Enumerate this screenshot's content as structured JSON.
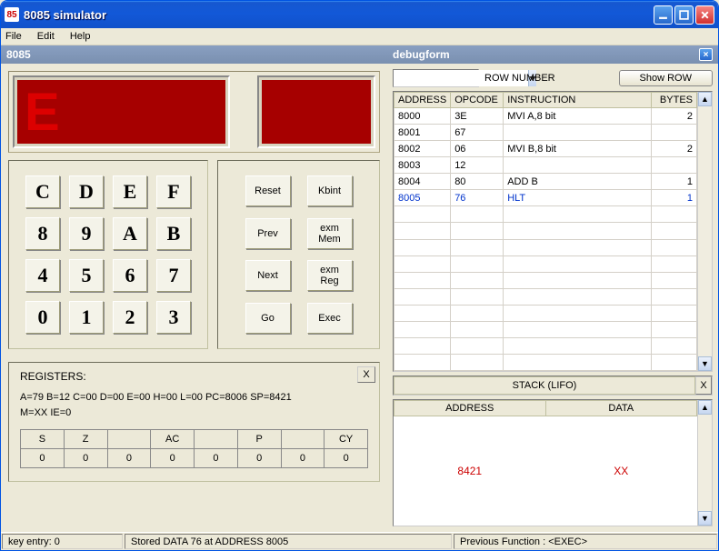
{
  "window": {
    "title": "8085 simulator"
  },
  "menu": {
    "file": "File",
    "edit": "Edit",
    "help": "Help"
  },
  "panel8085": {
    "title": "8085",
    "display_left": "E",
    "display_right": "",
    "keypad": [
      [
        "C",
        "D",
        "E",
        "F"
      ],
      [
        "8",
        "9",
        "A",
        "B"
      ],
      [
        "4",
        "5",
        "6",
        "7"
      ],
      [
        "0",
        "1",
        "2",
        "3"
      ]
    ],
    "ctrl": {
      "reset": "Reset",
      "kbint": "Kbint",
      "prev": "Prev",
      "exm_mem": "exm\nMem",
      "next": "Next",
      "exm_reg": "exm\nReg",
      "go": "Go",
      "exec": "Exec"
    },
    "registers": {
      "title": "REGISTERS:",
      "line1": "A=79  B=12  C=00  D=00  E=00  H=00  L=00  PC=8006  SP=8421",
      "line2": "M=XX  IE=0",
      "flags_hdr": [
        "S",
        "Z",
        "",
        "AC",
        "",
        "P",
        "",
        "CY"
      ],
      "flags_val": [
        "0",
        "0",
        "0",
        "0",
        "0",
        "0",
        "0",
        "0"
      ]
    }
  },
  "debug": {
    "title": "debugform",
    "rownum_label": "ROW NUMBER",
    "show_row_btn": "Show ROW",
    "columns": {
      "address": "ADDRESS",
      "opcode": "OPCODE",
      "instruction": "INSTRUCTION",
      "bytes": "BYTES"
    },
    "rows": [
      {
        "address": "8000",
        "opcode": "3E",
        "instruction": "MVI A,8 bit",
        "bytes": "2",
        "sel": false
      },
      {
        "address": "8001",
        "opcode": "67",
        "instruction": "",
        "bytes": "",
        "sel": false
      },
      {
        "address": "8002",
        "opcode": "06",
        "instruction": "MVI B,8 bit",
        "bytes": "2",
        "sel": false
      },
      {
        "address": "8003",
        "opcode": "12",
        "instruction": "",
        "bytes": "",
        "sel": false
      },
      {
        "address": "8004",
        "opcode": "80",
        "instruction": "ADD B",
        "bytes": "1",
        "sel": false
      },
      {
        "address": "8005",
        "opcode": "76",
        "instruction": "HLT",
        "bytes": "1",
        "sel": true
      }
    ],
    "stack_label": "STACK (LIFO)",
    "stack_cols": {
      "address": "ADDRESS",
      "data": "DATA"
    },
    "stack_rows": [
      {
        "address": "8421",
        "data": "XX"
      }
    ]
  },
  "status": {
    "key_entry": "key entry: 0",
    "stored": "Stored DATA 76 at ADDRESS 8005",
    "prev_fn": "Previous Function : <EXEC>"
  }
}
